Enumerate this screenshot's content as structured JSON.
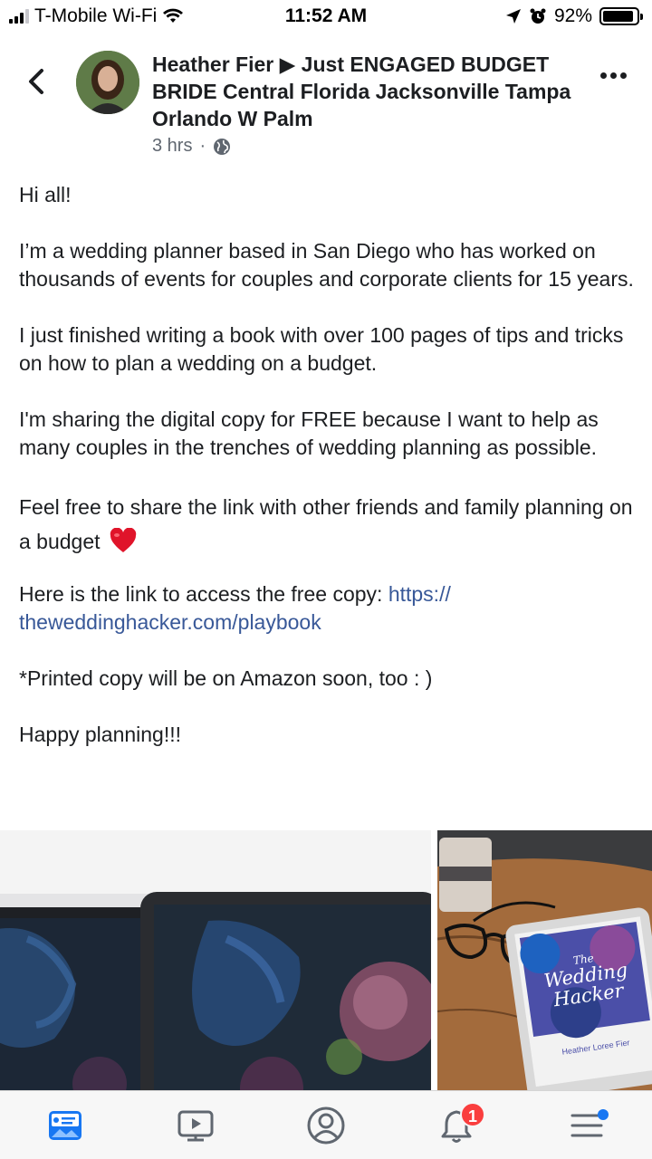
{
  "status_bar": {
    "carrier": "T-Mobile Wi-Fi",
    "time": "11:52 AM",
    "battery_percent": "92%",
    "battery_level": 0.92
  },
  "post": {
    "title": "Heather Fier ▶ Just ENGAGED BUDGET BRIDE Central Florida Jacksonville Tampa Orlando W Palm",
    "time_ago": "3 hrs",
    "meta_separator": "·",
    "paragraphs": {
      "p1": "Hi all!",
      "p2": "I’m a wedding planner based in San Diego who has worked on thousands of events for couples and corporate clients for 15 years.",
      "p3": "I just finished writing a book with over 100 pages of tips and tricks on how to plan a wedding on a budget.",
      "p4": "I'm sharing the digital copy for FREE because I want to help as many couples in the trenches of wedding planning as possible.",
      "p5": "Feel free to share the link with other friends and family planning on a budget",
      "p6_text": "Here is the link to access the free copy: ",
      "p6_link": "https:// theweddinghacker.com/playbook",
      "p7": "*Printed copy will be on Amazon soon, too : )",
      "p8": "Happy planning!!!"
    },
    "photo_book": {
      "title_line1": "The",
      "title_line2": "Wedding",
      "title_line3": "Hacker",
      "author": "Heather Loree Fier"
    }
  },
  "tab_bar": {
    "notifications_badge": "1"
  },
  "colors": {
    "link": "#385898",
    "badge": "#fa3e3e",
    "accent": "#1877f2"
  }
}
